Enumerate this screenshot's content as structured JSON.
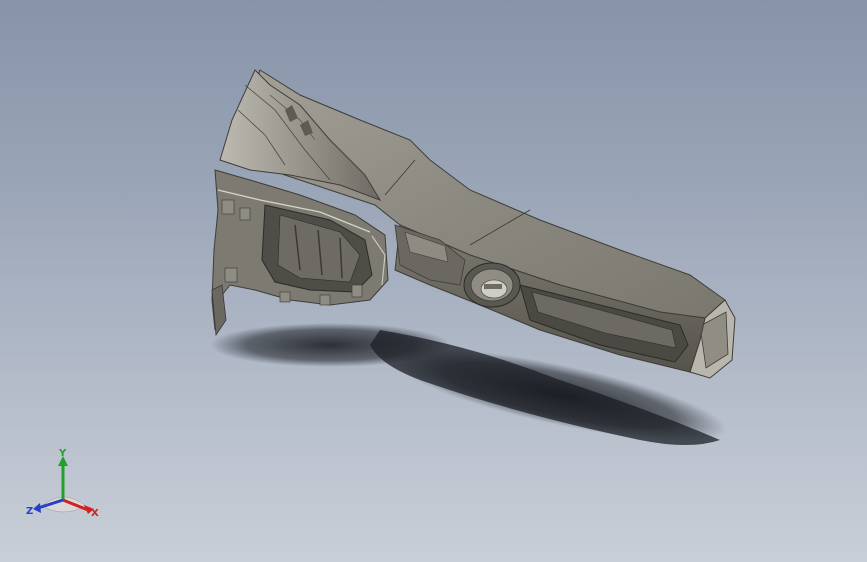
{
  "triad": {
    "x_label": "X",
    "y_label": "Y",
    "z_label": "Z",
    "x_color": "#d42020",
    "y_color": "#1fa12a",
    "z_color": "#2640c8"
  },
  "colors": {
    "part_top": "#8c8a80",
    "part_side": "#6f6c63",
    "part_dark": "#3f3d38",
    "shadow": "#1f2228"
  }
}
